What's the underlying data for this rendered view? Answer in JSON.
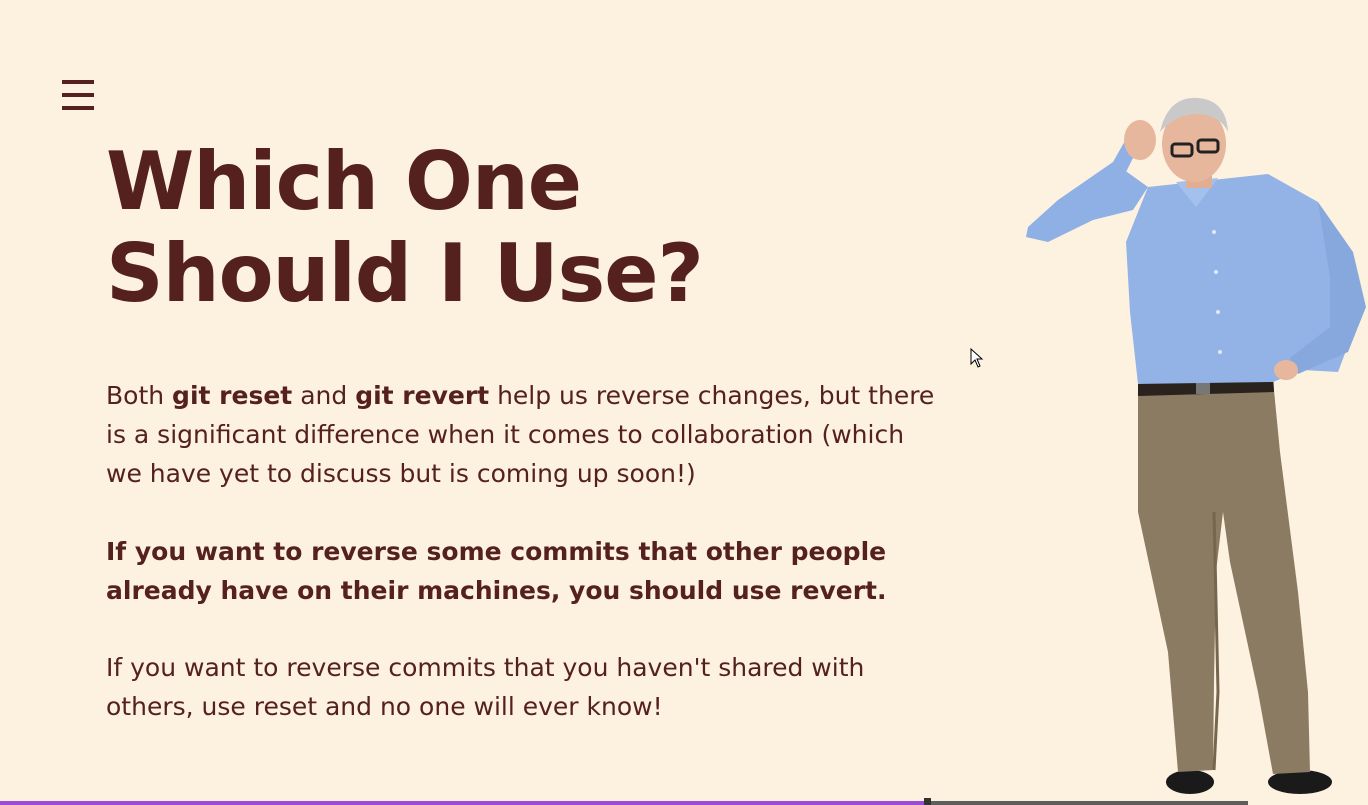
{
  "slide": {
    "title_line1": "Which One",
    "title_line2": "Should I Use?",
    "para1": {
      "t1": "Both ",
      "b1": "git reset",
      "t2": " and ",
      "b2": "git revert",
      "t3": " help us reverse changes, but there is a significant difference when it comes to collaboration (which we have yet to discuss but is coming up soon!)"
    },
    "para2": "If you want to reverse some commits that other people already have on their machines, you should use revert.",
    "para3": "If you want to reverse commits that you haven't shared with others, use reset and no one will ever know!"
  },
  "icons": {
    "menu": "hamburger-menu-icon",
    "cursor": "mouse-pointer-icon"
  },
  "progress": {
    "fraction": 0.74
  },
  "colors": {
    "background": "#fdf1df",
    "text": "#55211f",
    "progress_fill": "#9b4bd6",
    "progress_track": "#5e5e5e"
  }
}
